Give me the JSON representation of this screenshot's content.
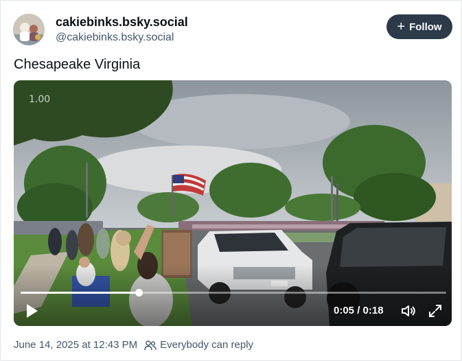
{
  "author": {
    "display_name": "cakiebinks.bsky.social",
    "handle": "@cakiebinks.bsky.social",
    "avatar_icon": "profile-avatar"
  },
  "follow_button": {
    "label": "Follow",
    "icon": "plus-icon"
  },
  "post": {
    "text": "Chesapeake Virginia"
  },
  "video": {
    "playback_rate": "1.00",
    "time_display": "0:05 / 0:18",
    "progress": 0.2778,
    "controls": {
      "play_icon": "play-icon",
      "volume_icon": "volume-icon",
      "fullscreen_icon": "fullscreen-icon"
    }
  },
  "footer": {
    "timestamp": "June 14, 2025 at 12:43 PM",
    "reply_setting": "Everybody can reply",
    "reply_icon": "people-icon"
  },
  "colors": {
    "follow_bg": "#2c3a4a",
    "muted_text": "#42576c"
  }
}
